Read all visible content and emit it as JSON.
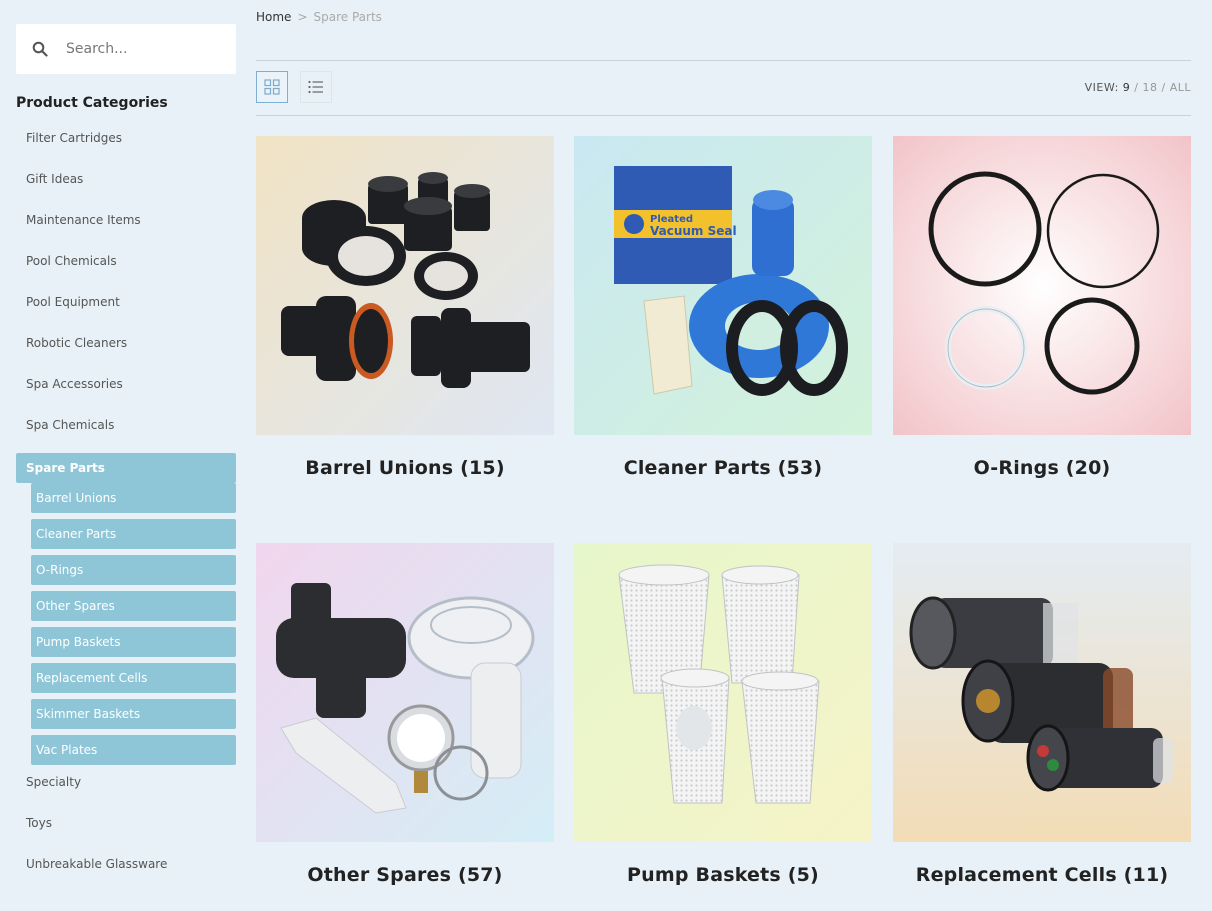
{
  "search": {
    "placeholder": "Search..."
  },
  "sidebar": {
    "title": "Product Categories",
    "items_before": [
      "Filter Cartridges",
      "Gift Ideas",
      "Maintenance Items",
      "Pool Chemicals",
      "Pool Equipment",
      "Robotic Cleaners",
      "Spa Accessories",
      "Spa Chemicals"
    ],
    "active": "Spare Parts",
    "sub_items": [
      "Barrel Unions",
      "Cleaner Parts",
      "O-Rings",
      "Other Spares",
      "Pump Baskets",
      "Replacement Cells",
      "Skimmer Baskets",
      "Vac Plates"
    ],
    "items_after": [
      "Specialty",
      "Toys",
      "Unbreakable Glassware"
    ]
  },
  "breadcrumb": {
    "home": "Home",
    "separator": ">",
    "current": "Spare Parts"
  },
  "view": {
    "label": "VIEW:",
    "options": [
      "9",
      "18",
      "ALL"
    ],
    "selected": "9"
  },
  "products": [
    {
      "title": "Barrel Unions (15)",
      "image_icon": "barrel-unions-image"
    },
    {
      "title": "Cleaner Parts (53)",
      "image_icon": "cleaner-parts-image",
      "package_label": "Pleated\nVacuum Seal"
    },
    {
      "title": "O-Rings (20)",
      "image_icon": "o-rings-image"
    },
    {
      "title": "Other Spares (57)",
      "image_icon": "other-spares-image"
    },
    {
      "title": "Pump Baskets (5)",
      "image_icon": "pump-baskets-image"
    },
    {
      "title": "Replacement Cells (11)",
      "image_icon": "replacement-cells-image"
    }
  ],
  "colors": {
    "background": "#e7f1f7",
    "accent": "#8ec6d8"
  }
}
